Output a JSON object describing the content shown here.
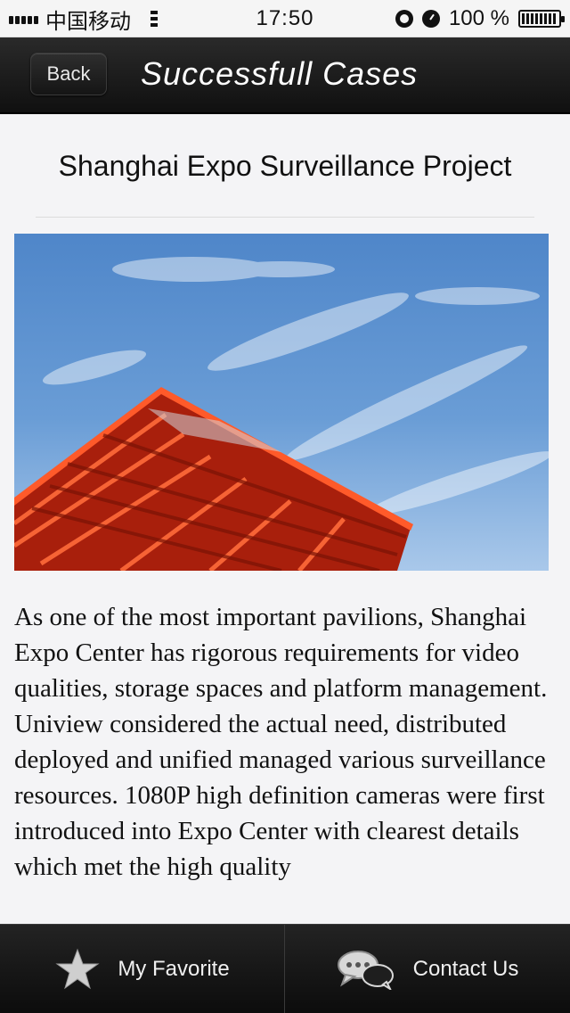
{
  "status_bar": {
    "carrier": "中国移动",
    "time": "17:50",
    "battery": "100 %"
  },
  "nav": {
    "back_label": "Back",
    "title": "Successfull Cases"
  },
  "article": {
    "title": "Shanghai Expo Surveillance Project",
    "image_icon": "expo-pavilion-photo",
    "body": "As one of the most important pavilions, Shanghai Expo Center has rigorous requirements for video qualities, storage spaces and platform management. Uniview considered the actual need, distributed deployed and unified managed various surveillance resources. 1080P high definition cameras were first introduced into Expo Center with clearest details which met the high quality"
  },
  "tab_bar": {
    "favorite_label": "My Favorite",
    "favorite_icon": "star-icon",
    "contact_label": "Contact Us",
    "contact_icon": "chat-bubbles-icon"
  },
  "colors": {
    "nav_background": "#1a1a1a",
    "pavilion_red": "#e03a1e",
    "sky_blue": "#5b8fcf"
  }
}
